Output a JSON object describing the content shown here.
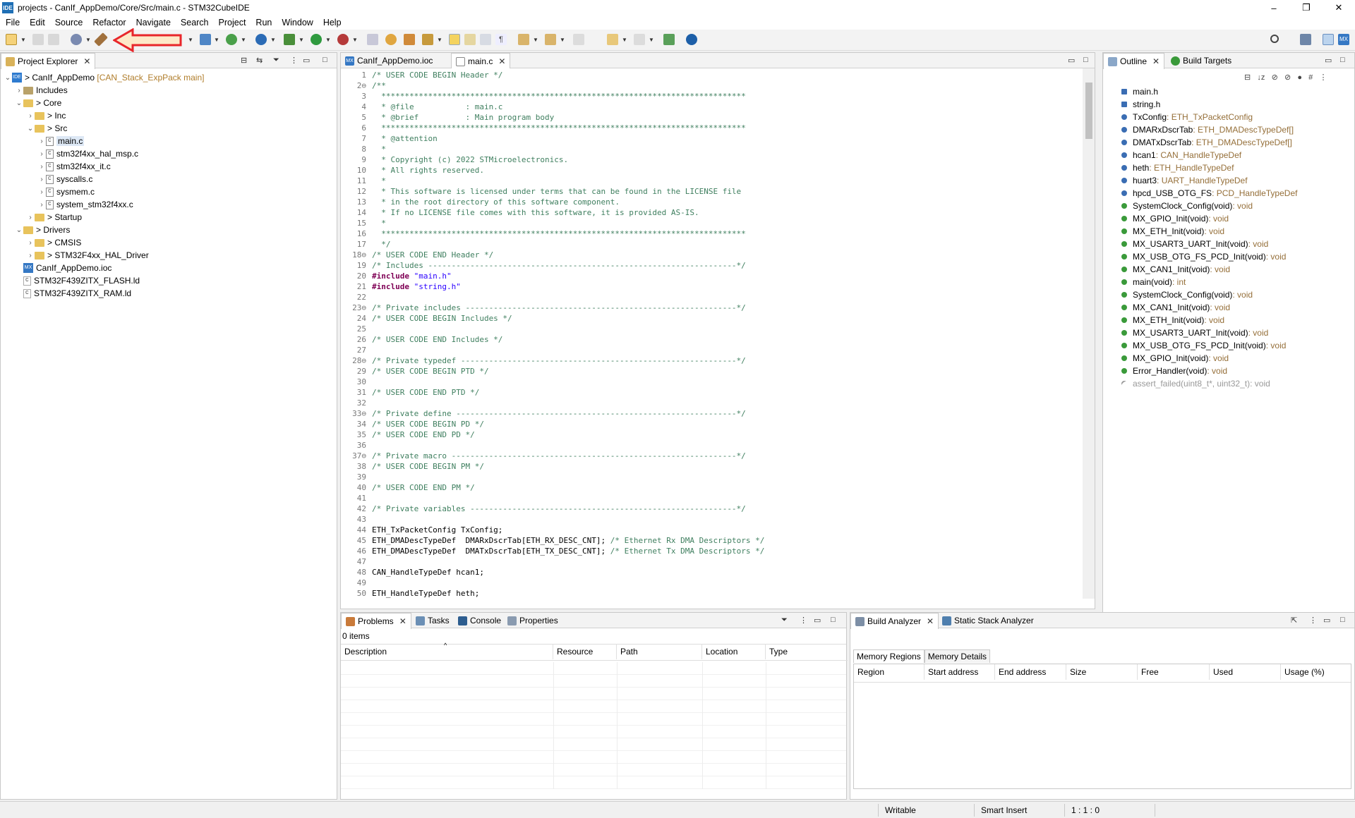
{
  "window": {
    "title": "projects - CanIf_AppDemo/Core/Src/main.c - STM32CubeIDE",
    "app_icon": "IDE",
    "minimize": "–",
    "maximize": "❐",
    "close": "✕"
  },
  "menu": [
    "File",
    "Edit",
    "Source",
    "Refactor",
    "Navigate",
    "Search",
    "Project",
    "Run",
    "Window",
    "Help"
  ],
  "project_explorer": {
    "tab_label": "Project Explorer",
    "items": [
      {
        "label": "CanIf_AppDemo",
        "suffix": "[CAN_Stack_ExpPack main]"
      },
      {
        "label": "Includes"
      },
      {
        "label": "Core"
      },
      {
        "label": "Inc"
      },
      {
        "label": "Src"
      },
      {
        "label": "main.c"
      },
      {
        "label": "stm32f4xx_hal_msp.c"
      },
      {
        "label": "stm32f4xx_it.c"
      },
      {
        "label": "syscalls.c"
      },
      {
        "label": "sysmem.c"
      },
      {
        "label": "system_stm32f4xx.c"
      },
      {
        "label": "Startup"
      },
      {
        "label": "Drivers"
      },
      {
        "label": "CMSIS"
      },
      {
        "label": "STM32F4xx_HAL_Driver"
      },
      {
        "label": "CanIf_AppDemo.ioc"
      },
      {
        "label": "STM32F439ZITX_FLASH.ld"
      },
      {
        "label": "STM32F439ZITX_RAM.ld"
      }
    ]
  },
  "editor": {
    "tabs": [
      {
        "label": "CanIf_AppDemo.ioc",
        "icon": "MX"
      },
      {
        "label": "main.c"
      }
    ],
    "lines": [
      {
        "n": "1",
        "t": "/* USER CODE BEGIN Header */",
        "k": "cm"
      },
      {
        "n": "2⊖",
        "t": "/**",
        "k": "cm"
      },
      {
        "n": "3",
        "t": "  ******************************************************************************",
        "k": "cm"
      },
      {
        "n": "4",
        "t": "  * @file           : main.c",
        "k": "cm"
      },
      {
        "n": "5",
        "t": "  * @brief          : Main program body",
        "k": "cm"
      },
      {
        "n": "6",
        "t": "  ******************************************************************************",
        "k": "cm"
      },
      {
        "n": "7",
        "t": "  * @attention",
        "k": "cm"
      },
      {
        "n": "8",
        "t": "  *",
        "k": "cm"
      },
      {
        "n": "9",
        "t": "  * Copyright (c) 2022 STMicroelectronics.",
        "k": "cm"
      },
      {
        "n": "10",
        "t": "  * All rights reserved.",
        "k": "cm"
      },
      {
        "n": "11",
        "t": "  *",
        "k": "cm"
      },
      {
        "n": "12",
        "t": "  * This software is licensed under terms that can be found in the LICENSE file",
        "k": "cm"
      },
      {
        "n": "13",
        "t": "  * in the root directory of this software component.",
        "k": "cm"
      },
      {
        "n": "14",
        "t": "  * If no LICENSE file comes with this software, it is provided AS-IS.",
        "k": "cm"
      },
      {
        "n": "15",
        "t": "  *",
        "k": "cm"
      },
      {
        "n": "16",
        "t": "  ******************************************************************************",
        "k": "cm"
      },
      {
        "n": "17",
        "t": "  */",
        "k": "cm"
      },
      {
        "n": "18⊖",
        "t": "/* USER CODE END Header */",
        "k": "cm"
      },
      {
        "n": "19",
        "t": "/* Includes ------------------------------------------------------------------*/",
        "k": "cm"
      },
      {
        "n": "20",
        "t": "#include \"main.h\"",
        "k": "inc"
      },
      {
        "n": "21",
        "t": "#include \"string.h\"",
        "k": "inc"
      },
      {
        "n": "22",
        "t": "",
        "k": ""
      },
      {
        "n": "23⊖",
        "t": "/* Private includes ----------------------------------------------------------*/",
        "k": "cm"
      },
      {
        "n": "24",
        "t": "/* USER CODE BEGIN Includes */",
        "k": "cm"
      },
      {
        "n": "25",
        "t": "",
        "k": ""
      },
      {
        "n": "26",
        "t": "/* USER CODE END Includes */",
        "k": "cm"
      },
      {
        "n": "27",
        "t": "",
        "k": ""
      },
      {
        "n": "28⊖",
        "t": "/* Private typedef -----------------------------------------------------------*/",
        "k": "cm"
      },
      {
        "n": "29",
        "t": "/* USER CODE BEGIN PTD */",
        "k": "cm"
      },
      {
        "n": "30",
        "t": "",
        "k": ""
      },
      {
        "n": "31",
        "t": "/* USER CODE END PTD */",
        "k": "cm"
      },
      {
        "n": "32",
        "t": "",
        "k": ""
      },
      {
        "n": "33⊖",
        "t": "/* Private define ------------------------------------------------------------*/",
        "k": "cm"
      },
      {
        "n": "34",
        "t": "/* USER CODE BEGIN PD */",
        "k": "cm"
      },
      {
        "n": "35",
        "t": "/* USER CODE END PD */",
        "k": "cm"
      },
      {
        "n": "36",
        "t": "",
        "k": ""
      },
      {
        "n": "37⊖",
        "t": "/* Private macro -------------------------------------------------------------*/",
        "k": "cm"
      },
      {
        "n": "38",
        "t": "/* USER CODE BEGIN PM */",
        "k": "cm"
      },
      {
        "n": "39",
        "t": "",
        "k": ""
      },
      {
        "n": "40",
        "t": "/* USER CODE END PM */",
        "k": "cm"
      },
      {
        "n": "41",
        "t": "",
        "k": ""
      },
      {
        "n": "42",
        "t": "/* Private variables ---------------------------------------------------------*/",
        "k": "cm"
      },
      {
        "n": "43",
        "t": "",
        "k": ""
      },
      {
        "n": "44",
        "t": "ETH_TxPacketConfig TxConfig;",
        "k": ""
      },
      {
        "n": "45",
        "t": "ETH_DMADescTypeDef  DMARxDscrTab[ETH_RX_DESC_CNT]; /* Ethernet Rx DMA Descriptors */",
        "k": "mix"
      },
      {
        "n": "46",
        "t": "ETH_DMADescTypeDef  DMATxDscrTab[ETH_TX_DESC_CNT]; /* Ethernet Tx DMA Descriptors */",
        "k": "mix"
      },
      {
        "n": "47",
        "t": "",
        "k": ""
      },
      {
        "n": "48",
        "t": "CAN_HandleTypeDef hcan1;",
        "k": ""
      },
      {
        "n": "49",
        "t": "",
        "k": ""
      },
      {
        "n": "50",
        "t": "ETH_HandleTypeDef heth;",
        "k": ""
      }
    ]
  },
  "outline": {
    "tabs": [
      "Outline",
      "Build Targets"
    ],
    "items": [
      {
        "name": "main.h",
        "type": "",
        "icon": "include",
        "color": "#3a6db3"
      },
      {
        "name": "string.h",
        "type": "",
        "icon": "include",
        "color": "#3a6db3"
      },
      {
        "name": "TxConfig",
        "type": " : ETH_TxPacketConfig",
        "icon": "var",
        "color": "#3a6db3"
      },
      {
        "name": "DMARxDscrTab",
        "type": " : ETH_DMADescTypeDef[]",
        "icon": "var",
        "color": "#3a6db3"
      },
      {
        "name": "DMATxDscrTab",
        "type": " : ETH_DMADescTypeDef[]",
        "icon": "var",
        "color": "#3a6db3"
      },
      {
        "name": "hcan1",
        "type": " : CAN_HandleTypeDef",
        "icon": "var",
        "color": "#3a6db3"
      },
      {
        "name": "heth",
        "type": " : ETH_HandleTypeDef",
        "icon": "var",
        "color": "#3a6db3"
      },
      {
        "name": "huart3",
        "type": " : UART_HandleTypeDef",
        "icon": "var",
        "color": "#3a6db3"
      },
      {
        "name": "hpcd_USB_OTG_FS",
        "type": " : PCD_HandleTypeDef",
        "icon": "var",
        "color": "#3a6db3"
      },
      {
        "name": "SystemClock_Config(void)",
        "type": " : void",
        "icon": "decl",
        "color": "#3a9a3a"
      },
      {
        "name": "MX_GPIO_Init(void)",
        "type": " : void",
        "icon": "decl-s",
        "color": "#3a9a3a"
      },
      {
        "name": "MX_ETH_Init(void)",
        "type": " : void",
        "icon": "decl-s",
        "color": "#3a9a3a"
      },
      {
        "name": "MX_USART3_UART_Init(void)",
        "type": " : void",
        "icon": "decl-s",
        "color": "#3a9a3a"
      },
      {
        "name": "MX_USB_OTG_FS_PCD_Init(void)",
        "type": " : void",
        "icon": "decl-s",
        "color": "#3a9a3a"
      },
      {
        "name": "MX_CAN1_Init(void)",
        "type": " : void",
        "icon": "decl-s",
        "color": "#3a9a3a"
      },
      {
        "name": "main(void)",
        "type": " : int",
        "icon": "func",
        "color": "#3a9a3a"
      },
      {
        "name": "SystemClock_Config(void)",
        "type": " : void",
        "icon": "func",
        "color": "#3a9a3a"
      },
      {
        "name": "MX_CAN1_Init(void)",
        "type": " : void",
        "icon": "func-s",
        "color": "#3a9a3a"
      },
      {
        "name": "MX_ETH_Init(void)",
        "type": " : void",
        "icon": "func-s",
        "color": "#3a9a3a"
      },
      {
        "name": "MX_USART3_UART_Init(void)",
        "type": " : void",
        "icon": "func-s",
        "color": "#3a9a3a"
      },
      {
        "name": "MX_USB_OTG_FS_PCD_Init(void)",
        "type": " : void",
        "icon": "func-s",
        "color": "#3a9a3a"
      },
      {
        "name": "MX_GPIO_Init(void)",
        "type": " : void",
        "icon": "func-s",
        "color": "#3a9a3a"
      },
      {
        "name": "Error_Handler(void)",
        "type": " : void",
        "icon": "func",
        "color": "#3a9a3a"
      },
      {
        "name": "assert_failed(uint8_t*, uint32_t)",
        "type": " : void",
        "icon": "inactive",
        "color": "#999999"
      }
    ]
  },
  "problems": {
    "tabs": [
      "Problems",
      "Tasks",
      "Console",
      "Properties"
    ],
    "count": "0 items",
    "columns": [
      "Description",
      "Resource",
      "Path",
      "Location",
      "Type"
    ]
  },
  "build_analyzer": {
    "tabs": [
      "Build Analyzer",
      "Static Stack Analyzer"
    ],
    "subtabs": [
      "Memory Regions",
      "Memory Details"
    ],
    "columns": [
      "Region",
      "Start address",
      "End address",
      "Size",
      "Free",
      "Used",
      "Usage (%)"
    ]
  },
  "status": {
    "writable": "Writable",
    "insert": "Smart Insert",
    "position": "1 : 1 : 0"
  },
  "colors": {
    "annotation_arrow": "#e8262a",
    "annotation_fill": "#fde9c8"
  }
}
